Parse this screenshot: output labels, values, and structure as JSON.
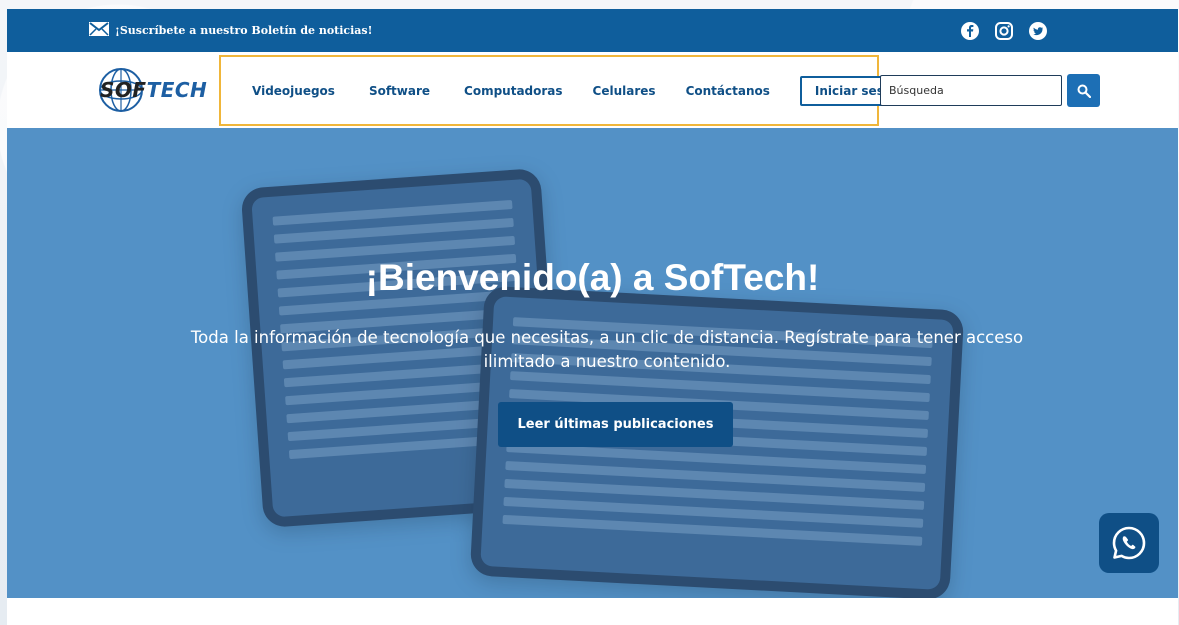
{
  "topbar": {
    "newsletter_label": "¡Suscríbete a nuestro Boletín de noticias!",
    "icons": [
      "mail-icon",
      "facebook-icon",
      "instagram-icon",
      "twitter-icon"
    ]
  },
  "brand": {
    "logo_sof": "SOF",
    "logo_tech": "TECH"
  },
  "nav": {
    "links": [
      {
        "label": "Videojuegos"
      },
      {
        "label": "Software"
      },
      {
        "label": "Computadoras"
      },
      {
        "label": "Celulares"
      },
      {
        "label": "Contáctanos"
      }
    ],
    "login_label": "Iniciar sesión"
  },
  "search": {
    "placeholder": "Búsqueda",
    "icon": "search-icon"
  },
  "hero": {
    "title": "¡Bienvenido(a) a SofTech!",
    "subtitle": "Toda la información de tecnología que necesitas, a un clic de distancia. Regístrate para tener acceso ilimitado a nuestro contenido.",
    "cta_label": "Leer últimas publicaciones"
  },
  "whatsapp": {
    "icon": "whatsapp-icon"
  },
  "colors": {
    "primary": "#0f5e9c",
    "hero_bg": "#5b9acb",
    "highlight_border": "#f0b63a"
  }
}
